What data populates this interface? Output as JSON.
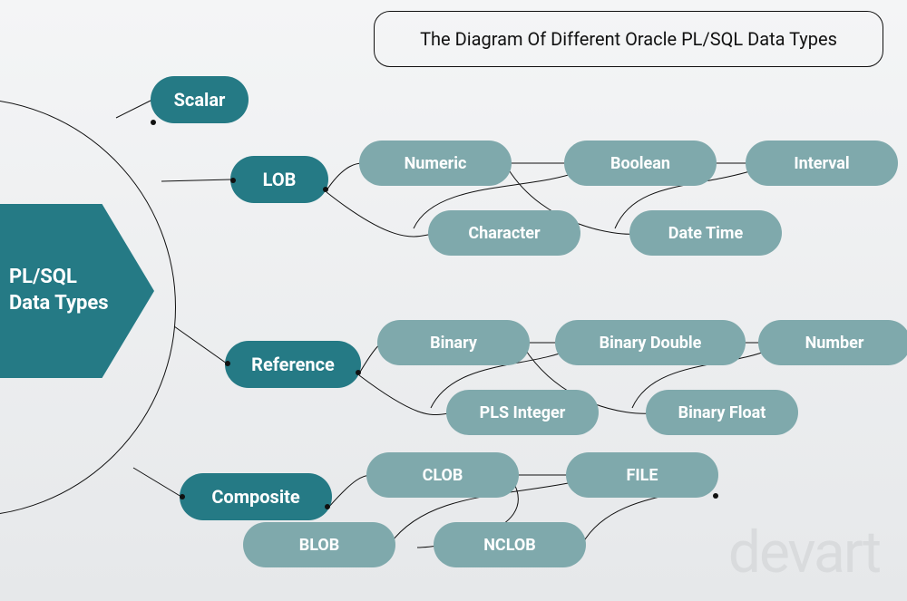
{
  "title": "The Diagram Of Different Oracle PL/SQL Data Types",
  "root_line1": "PL/SQL",
  "root_line2": "Data Types",
  "categories": {
    "scalar": "Scalar",
    "lob": "LOB",
    "reference": "Reference",
    "composite": "Composite"
  },
  "scalar_subtypes": {
    "numeric": "Numeric",
    "boolean": "Boolean",
    "interval": "Interval",
    "character": "Character",
    "datetime": "Date Time"
  },
  "numeric_subtypes": {
    "binary": "Binary",
    "binary_double": "Binary Double",
    "number": "Number",
    "pls_integer": "PLS Integer",
    "binary_float": "Binary Float"
  },
  "lob_subtypes": {
    "clob": "CLOB",
    "file": "FILE",
    "blob": "BLOB",
    "nclob": "NCLOB"
  },
  "watermark": "devart"
}
